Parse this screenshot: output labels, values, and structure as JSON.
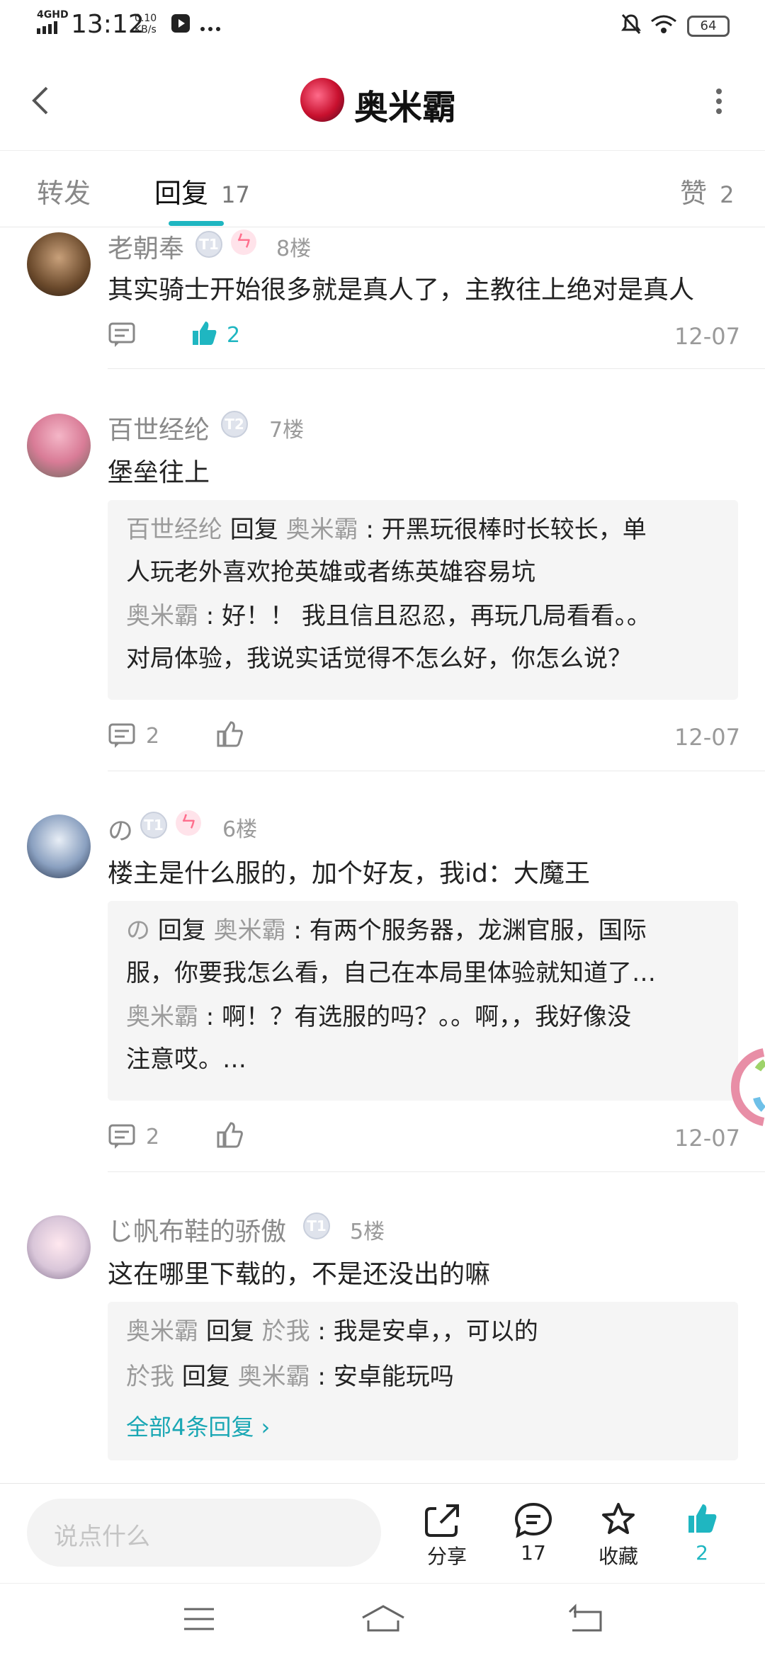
{
  "status_bar": {
    "network": "4GHD",
    "time": "13:12",
    "speed_value": "0.10",
    "speed_unit": "KB/s",
    "battery": "64"
  },
  "header": {
    "title": "奥米霸"
  },
  "tabs": [
    {
      "label": "转发",
      "count": ""
    },
    {
      "label": "回复",
      "count": "17"
    },
    {
      "label": "赞",
      "count": "2"
    }
  ],
  "comments": [
    {
      "name": "老朝奉",
      "badge": "T1",
      "badge2": "ㄣ",
      "floor": "8楼",
      "text": "其实骑士开始很多就是真人了，主教往上绝对是真人",
      "reply_count": "",
      "like_count": "2",
      "date": "12-07"
    },
    {
      "name": "百世经纶",
      "badge": "T2",
      "floor": "7楼",
      "text": "堡垒往上",
      "replies": [
        {
          "from": "百世经纶",
          "verb": "回复",
          "to": "奥米霸",
          "text": "开黑玩很棒时长较长，单",
          "text2": "人玩老外喜欢抢英雄或者练英雄容易坑"
        },
        {
          "from": "奥米霸",
          "text": "好！！ 我且信且忍忍，再玩几局看看。。",
          "text2": "对局体验，我说实话觉得不怎么好，你怎么说？"
        }
      ],
      "reply_count": "2",
      "date": "12-07"
    },
    {
      "name": "の",
      "badge": "T1",
      "badge2": "ㄣ",
      "floor": "6楼",
      "text": "楼主是什么服的，加个好友，我id：大魔王",
      "replies": [
        {
          "from": "の",
          "verb": "回复",
          "to": "奥米霸",
          "text": "有两个服务器，龙渊官服，国际",
          "text2": "服，你要我怎么看，自己在本局里体验就知道了…"
        },
        {
          "from": "奥米霸",
          "text": "啊！？有选服的吗？。。啊，，我好像没",
          "text2": "注意哎。…"
        }
      ],
      "reply_count": "2",
      "date": "12-07"
    },
    {
      "name": "じ帆布鞋的骄傲",
      "badge": "T1",
      "floor": "5楼",
      "text": "这在哪里下载的，不是还没出的嘛",
      "replies": [
        {
          "from": "奥米霸",
          "verb": "回复",
          "to": "於我",
          "text": "我是安卓，，可以的"
        },
        {
          "from": "於我",
          "verb": "回复",
          "to": "奥米霸",
          "text": "安卓能玩吗"
        }
      ],
      "more_replies": "全部4条回复 ›"
    }
  ],
  "bottom_bar": {
    "input_placeholder": "说点什么",
    "share_label": "分享",
    "comment_count": "17",
    "favorite_label": "收藏",
    "like_count": "2"
  },
  "colors": {
    "accent": "#1fb6c1"
  }
}
